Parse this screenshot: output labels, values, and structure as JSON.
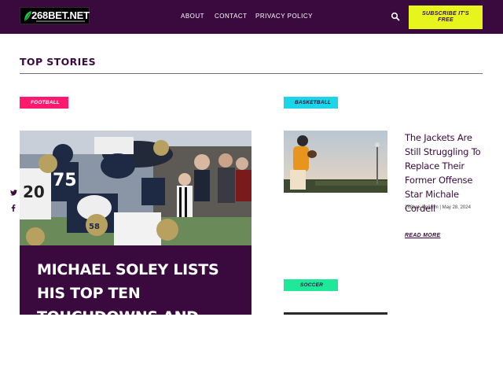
{
  "header": {
    "logo_text": "268BET.NET",
    "nav": [
      "ABOUT",
      "CONTACT",
      "PRIVACY POLICY"
    ],
    "search_icon": "search-icon",
    "subscribe_line1": "SUBSCRIBE IT'S",
    "subscribe_line2": "FREE"
  },
  "section": {
    "title": "TOP STORIES"
  },
  "featured": {
    "category": "FOOTBALL",
    "title": "MICHAEL SOLEY LISTS HIS TOP TEN TOUCHDOWNS AND BEST PLAYERS OF THE SEASON"
  },
  "social": [
    "twitter-icon",
    "facebook-icon"
  ],
  "side_story": {
    "category": "BASKETBALL",
    "title": "The Jackets Are Still Struggling To Replace Their Former Offense Star Michale Cordell",
    "meta": "268bet_kjp3mm | May 28, 2024",
    "read_more": "READ MORE"
  },
  "next_story": {
    "category": "SOCCER"
  },
  "colors": {
    "brand": "#3a0a3f",
    "accent": "#e6f51c",
    "football_badge": "#ff1a6e",
    "basketball_badge": "#1ad6e8",
    "soccer_badge": "#1ee89a"
  }
}
